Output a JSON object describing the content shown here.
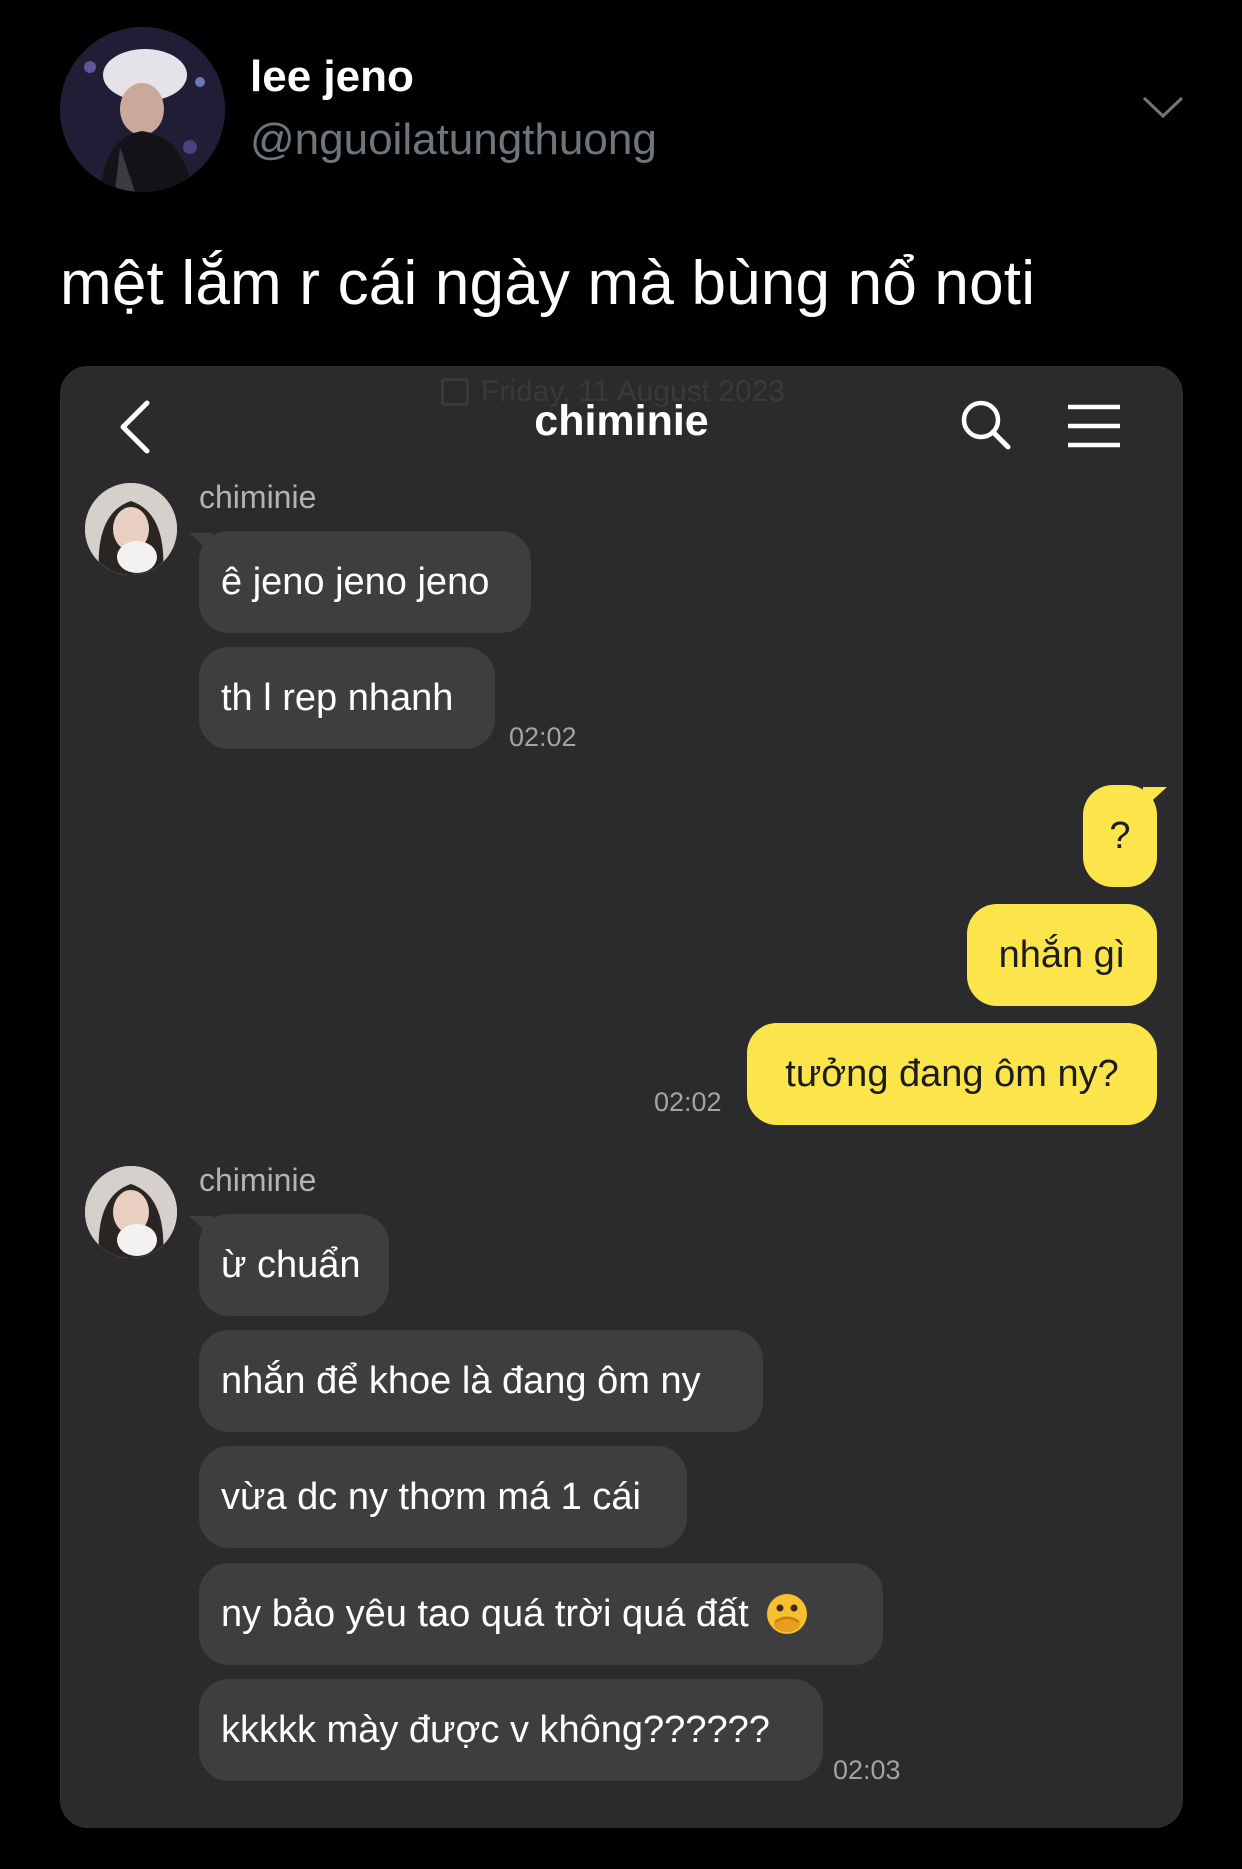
{
  "tweet": {
    "display_name": "lee jeno",
    "handle": "@nguoilatungthuong",
    "text": "mệt lắm r cái ngày mà bùng nổ noti",
    "menu_icon": "chevron-down-icon"
  },
  "chat": {
    "date_ghost": "Friday, 11 August 2023",
    "title": "chiminie",
    "icons": [
      "back-icon",
      "search-icon",
      "menu-icon"
    ],
    "incoming_color": "#3e3e41",
    "outgoing_color": "#fbe54b",
    "group1": {
      "sender": "chiminie",
      "messages": [
        "ê jeno jeno jeno",
        "th l rep nhanh"
      ],
      "time": "02:02"
    },
    "group2": {
      "messages": [
        "?",
        "nhắn gì",
        "tưởng đang ôm ny?"
      ],
      "time": "02:02"
    },
    "group3": {
      "sender": "chiminie",
      "messages": [
        "ừ chuẩn",
        "nhắn để khoe là đang ôm ny",
        "vừa dc ny thơm má 1 cái",
        "ny bảo yêu tao quá trời quá đất",
        "kkkkk mày được v không??????"
      ],
      "emoji": "face-with-hand-over-mouth-icon",
      "time": "02:03"
    }
  }
}
